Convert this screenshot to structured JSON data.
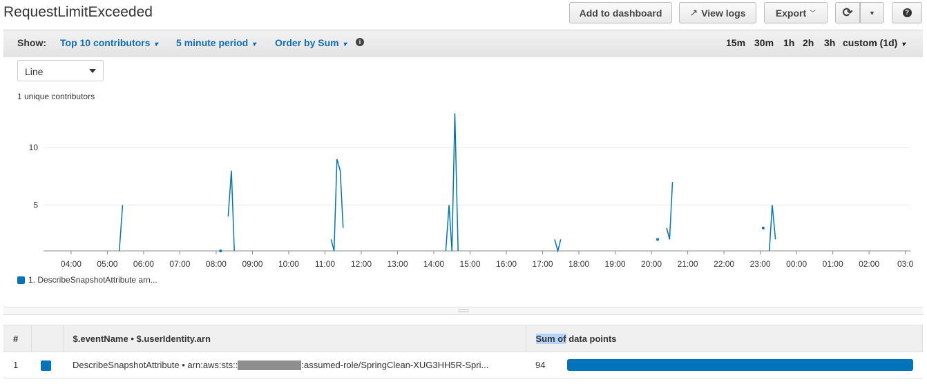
{
  "header": {
    "title": "RequestLimitExceeded",
    "add_to_dashboard": "Add to dashboard",
    "view_logs": "View logs",
    "export": "Export"
  },
  "toolbar": {
    "show_label": "Show:",
    "contributors": "Top 10 contributors",
    "period": "5 minute period",
    "order": "Order by Sum",
    "ranges": [
      "15m",
      "30m",
      "1h",
      "2h",
      "3h"
    ],
    "custom": "custom (1d)"
  },
  "chart_type": "Line",
  "unique_contributors": "1 unique contributors",
  "legend": "1. DescribeSnapshotAttribute arn...",
  "colors": {
    "series": "#0073bb",
    "link": "#0f6cb6"
  },
  "chart_data": {
    "type": "line",
    "xlim": [
      3.24,
      27.14
    ],
    "ylim": [
      1,
      14.7
    ],
    "ytick_values": [
      5,
      10
    ],
    "ytick_labels": [
      "5",
      "10"
    ],
    "xtick_labels": [
      "04:00",
      "05:00",
      "06:00",
      "07:00",
      "08:00",
      "09:00",
      "10:00",
      "11:00",
      "12:00",
      "13:00",
      "14:00",
      "15:00",
      "16:00",
      "17:00",
      "18:00",
      "19:00",
      "20:00",
      "21:00",
      "22:00",
      "23:00",
      "00:00",
      "01:00",
      "02:00",
      "03:0"
    ],
    "series": [
      {
        "name": "1. DescribeSnapshotAttribute arn...",
        "segments": [
          [
            [
              5.33,
              1
            ],
            [
              5.42,
              5
            ]
          ],
          [
            [
              8.12,
              1
            ]
          ],
          [
            [
              8.33,
              4
            ],
            [
              8.42,
              8
            ],
            [
              8.5,
              1
            ]
          ],
          [
            [
              11.17,
              2
            ],
            [
              11.25,
              1
            ],
            [
              11.33,
              9
            ],
            [
              11.42,
              8
            ],
            [
              11.5,
              3
            ]
          ],
          [
            [
              14.33,
              1
            ],
            [
              14.42,
              5
            ],
            [
              14.5,
              1
            ],
            [
              14.58,
              13
            ],
            [
              14.67,
              1
            ]
          ],
          [
            [
              17.33,
              2
            ],
            [
              17.42,
              1
            ],
            [
              17.5,
              2
            ]
          ],
          [
            [
              20.17,
              2
            ]
          ],
          [
            [
              20.42,
              3
            ],
            [
              20.5,
              2
            ],
            [
              20.58,
              7
            ]
          ],
          [
            [
              23.08,
              3
            ]
          ],
          [
            [
              23.25,
              1
            ],
            [
              23.33,
              5
            ],
            [
              23.42,
              2
            ]
          ]
        ]
      }
    ]
  },
  "table": {
    "headers": [
      "#",
      "",
      "$.eventName • $.userIdentity.arn",
      "Sum of",
      "data points"
    ],
    "rows": [
      {
        "rank": "1",
        "label_a": "DescribeSnapshotAttribute • arn:aws:sts::",
        "label_b": ":assumed-role/SpringClean-XUG3HH5R-Spri...",
        "sum": "94",
        "fraction": 1.0
      }
    ]
  }
}
